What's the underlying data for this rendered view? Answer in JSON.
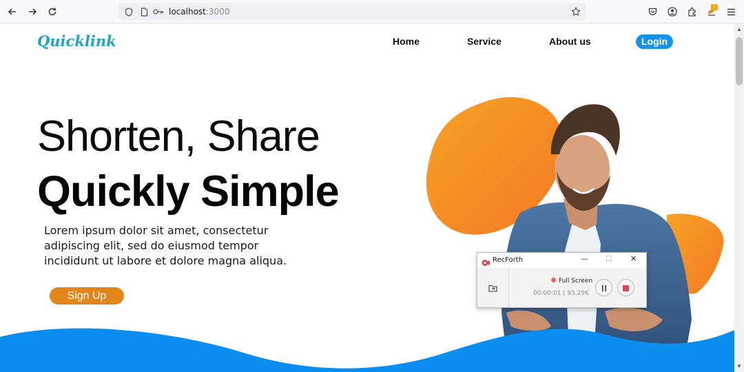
{
  "browser": {
    "url_host": "localhost",
    "url_port": ":3000",
    "extension_badge": "1",
    "icons": [
      "back-icon",
      "forward-icon",
      "reload-icon",
      "shield-icon",
      "page-icon",
      "key-icon",
      "bookmark-star-icon",
      "pocket-icon",
      "account-icon",
      "extensions-icon",
      "extension-badge-icon",
      "menu-icon"
    ]
  },
  "site": {
    "logo": "Quicklink",
    "nav": {
      "home": "Home",
      "service": "Service",
      "about": "About us",
      "login": "Login"
    },
    "hero": {
      "line1": "Shorten, Share",
      "line2": "Quickly Simple",
      "description": "Lorem ipsum dolor sit amet, consectetur adipiscing elit, sed do eiusmod tempor incididunt ut labore et dolore magna aliqua.",
      "cta": "Sign Up"
    },
    "colors": {
      "brand": "#1fa3c9",
      "login": "#1593e6",
      "cta": "#e2861c",
      "wave": "#0a8ff0",
      "blob": "#f59a22"
    }
  },
  "recorder": {
    "title": "RecForth",
    "mode": "Full Screen",
    "time": "00:00:01",
    "size": "93.29K"
  }
}
